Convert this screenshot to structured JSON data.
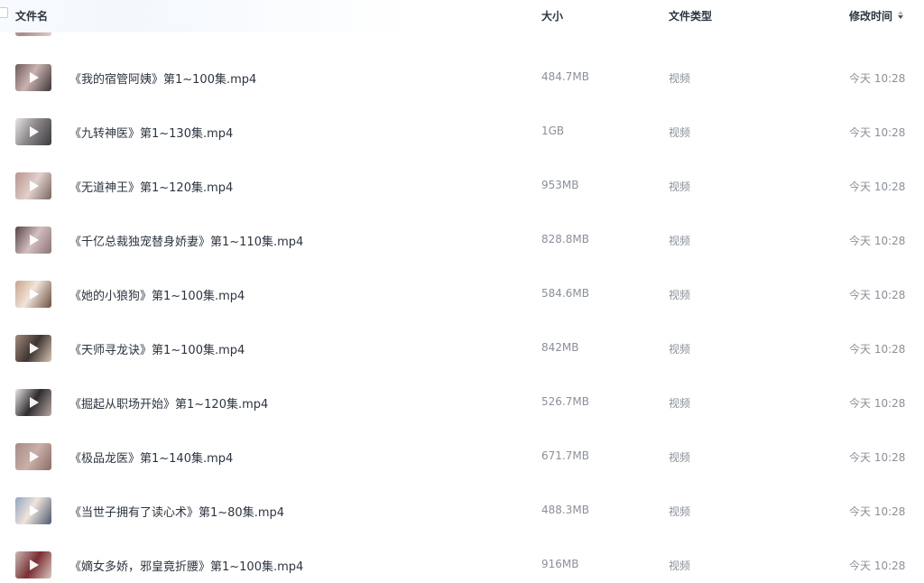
{
  "header": {
    "name": "文件名",
    "size": "大小",
    "type": "文件类型",
    "modified": "修改时间",
    "sort_icon": "sort-desc-icon"
  },
  "files": [
    {
      "name": "《我的宿管阿姨》第1~100集.mp4",
      "size": "484.7MB",
      "type": "视频",
      "time": "今天 10:28"
    },
    {
      "name": "《九转神医》第1~130集.mp4",
      "size": "1GB",
      "type": "视频",
      "time": "今天 10:28"
    },
    {
      "name": "《无道神王》第1~120集.mp4",
      "size": "953MB",
      "type": "视频",
      "time": "今天 10:28"
    },
    {
      "name": "《千亿总裁独宠替身娇妻》第1~110集.mp4",
      "size": "828.8MB",
      "type": "视频",
      "time": "今天 10:28"
    },
    {
      "name": "《她的小狼狗》第1~100集.mp4",
      "size": "584.6MB",
      "type": "视频",
      "time": "今天 10:28"
    },
    {
      "name": "《天师寻龙诀》第1~100集.mp4",
      "size": "842MB",
      "type": "视频",
      "time": "今天 10:28"
    },
    {
      "name": "《掘起从职场开始》第1~120集.mp4",
      "size": "526.7MB",
      "type": "视频",
      "time": "今天 10:28"
    },
    {
      "name": "《极品龙医》第1~140集.mp4",
      "size": "671.7MB",
      "type": "视频",
      "time": "今天 10:28"
    },
    {
      "name": "《当世子拥有了读心术》第1~80集.mp4",
      "size": "488.3MB",
      "type": "视频",
      "time": "今天 10:28"
    },
    {
      "name": "《嫡女多娇，邪皇竟折腰》第1~100集.mp4",
      "size": "916MB",
      "type": "视频",
      "time": "今天 10:28"
    }
  ]
}
